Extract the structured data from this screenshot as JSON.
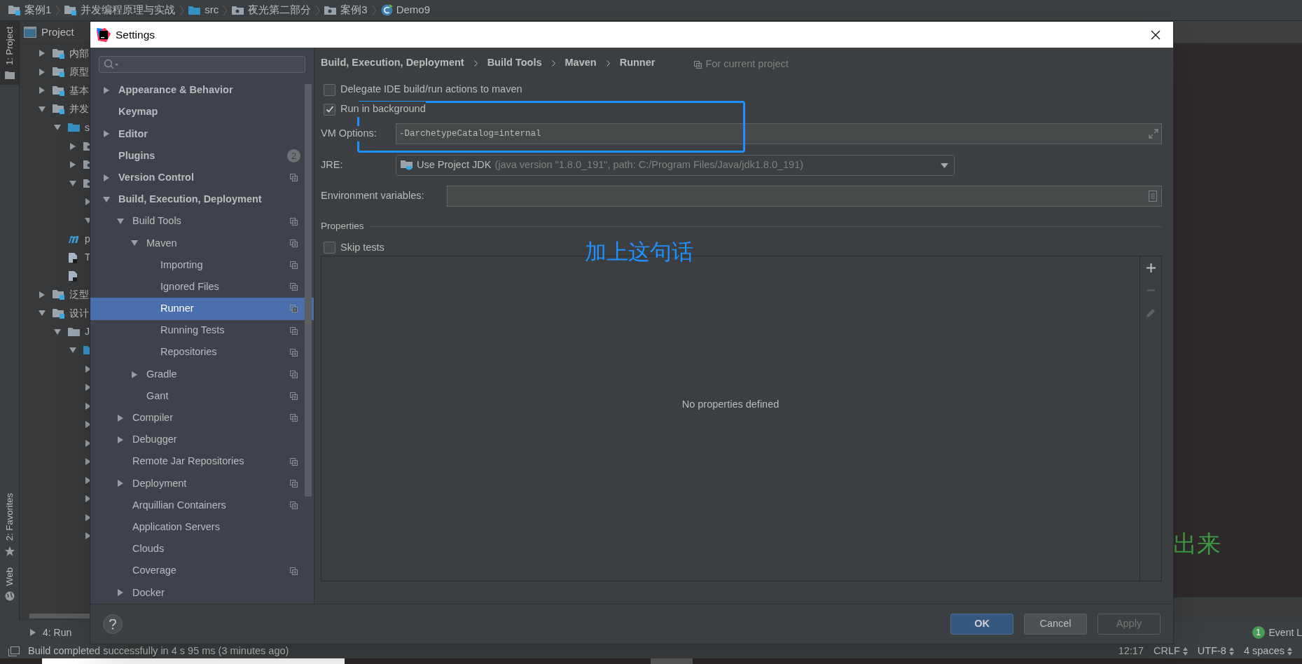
{
  "breadcrumbs": [
    {
      "label": "案例1",
      "kind": "module"
    },
    {
      "label": "并发编程原理与实战",
      "kind": "module"
    },
    {
      "label": "src",
      "kind": "source"
    },
    {
      "label": "夜光第二部分",
      "kind": "package"
    },
    {
      "label": "案例3",
      "kind": "package"
    },
    {
      "label": "Demo9",
      "kind": "class"
    }
  ],
  "side_tabs": [
    {
      "label": "1: Project",
      "kind": "project",
      "selected": true
    },
    {
      "label": "2: Favorites",
      "kind": "favorites",
      "selected": false
    },
    {
      "label": "Web",
      "kind": "web",
      "selected": false
    }
  ],
  "project_panel": {
    "title": "Project",
    "tree": [
      {
        "label": "内部",
        "kind": "module",
        "expanded": false
      },
      {
        "label": "原型",
        "kind": "module",
        "expanded": false
      },
      {
        "label": "基本",
        "kind": "module",
        "expanded": false
      },
      {
        "label": "并发",
        "kind": "module",
        "expanded": true,
        "children": [
          {
            "label": "s",
            "kind": "source",
            "expanded": true,
            "children": [
              {
                "kind": "package",
                "expanded": false
              },
              {
                "kind": "package",
                "expanded": false
              },
              {
                "kind": "package",
                "expanded": true,
                "children": [
                  {
                    "expanded": false
                  },
                  {
                    "expanded": true
                  }
                ]
              }
            ]
          },
          {
            "label": "p",
            "kind": "pom"
          },
          {
            "label": "T",
            "kind": "file"
          },
          {
            "kind": "file"
          }
        ]
      },
      {
        "label": "泛型",
        "kind": "module",
        "expanded": false
      },
      {
        "label": "设计",
        "kind": "module",
        "expanded": true,
        "children": [
          {
            "label": "J",
            "kind": "folder",
            "expanded": true,
            "children": [
              {
                "kind": "source",
                "expanded": true,
                "children": [
                  {
                    "expanded": false
                  },
                  {
                    "expanded": false
                  },
                  {
                    "expanded": false
                  },
                  {
                    "expanded": false
                  },
                  {
                    "expanded": false
                  },
                  {
                    "expanded": false
                  },
                  {
                    "expanded": false
                  },
                  {
                    "expanded": false
                  },
                  {
                    "expanded": false
                  },
                  {
                    "expanded": false
                  }
                ]
              }
            ]
          }
        ]
      }
    ]
  },
  "editor": {
    "text": "出来"
  },
  "settings_dialog": {
    "title": "Settings",
    "tree": [
      {
        "label": "Appearance & Behavior",
        "kind": "group",
        "expanded": false,
        "project": false,
        "selected": false
      },
      {
        "label": "Keymap",
        "kind": "leaf",
        "project": false,
        "selected": false
      },
      {
        "label": "Editor",
        "kind": "group",
        "expanded": false,
        "project": false,
        "selected": false
      },
      {
        "label": "Plugins",
        "kind": "leaf",
        "project": false,
        "selected": false,
        "badge": "2"
      },
      {
        "label": "Version Control",
        "kind": "group",
        "expanded": false,
        "project": true,
        "selected": false
      },
      {
        "label": "Build, Execution, Deployment",
        "kind": "group",
        "expanded": true,
        "project": false,
        "selected": false,
        "children": [
          {
            "label": "Build Tools",
            "kind": "group",
            "expanded": true,
            "project": true,
            "selected": false,
            "children": [
              {
                "label": "Maven",
                "kind": "group",
                "expanded": true,
                "project": true,
                "selected": false,
                "children": [
                  {
                    "label": "Importing",
                    "kind": "leaf",
                    "project": true,
                    "selected": false
                  },
                  {
                    "label": "Ignored Files",
                    "kind": "leaf",
                    "project": true,
                    "selected": false
                  },
                  {
                    "label": "Runner",
                    "kind": "leaf",
                    "project": true,
                    "selected": true
                  },
                  {
                    "label": "Running Tests",
                    "kind": "leaf",
                    "project": true,
                    "selected": false
                  },
                  {
                    "label": "Repositories",
                    "kind": "leaf",
                    "project": true,
                    "selected": false
                  }
                ]
              },
              {
                "label": "Gradle",
                "kind": "group",
                "expanded": false,
                "project": true,
                "selected": false
              },
              {
                "label": "Gant",
                "kind": "leaf",
                "project": true,
                "selected": false
              }
            ]
          },
          {
            "label": "Compiler",
            "kind": "group",
            "expanded": false,
            "project": true,
            "selected": false
          },
          {
            "label": "Debugger",
            "kind": "group",
            "expanded": false,
            "project": false,
            "selected": false
          },
          {
            "label": "Remote Jar Repositories",
            "kind": "leaf",
            "project": true,
            "selected": false
          },
          {
            "label": "Deployment",
            "kind": "group",
            "expanded": false,
            "project": true,
            "selected": false
          },
          {
            "label": "Arquillian Containers",
            "kind": "leaf",
            "project": true,
            "selected": false
          },
          {
            "label": "Application Servers",
            "kind": "leaf",
            "project": false,
            "selected": false
          },
          {
            "label": "Clouds",
            "kind": "leaf",
            "project": false,
            "selected": false
          },
          {
            "label": "Coverage",
            "kind": "leaf",
            "project": true,
            "selected": false
          },
          {
            "label": "Docker",
            "kind": "group",
            "expanded": false,
            "project": false,
            "selected": false
          }
        ]
      }
    ],
    "breadcrumb": [
      "Build, Execution, Deployment",
      "Build Tools",
      "Maven",
      "Runner"
    ],
    "scope_note": "For current project",
    "options": [
      {
        "kind": "checkbox",
        "label": "Delegate IDE build/run actions to maven",
        "checked": false
      },
      {
        "kind": "checkbox",
        "label": "Run in background",
        "checked": true
      },
      {
        "kind": "text",
        "label": "VM Options:",
        "value": "-DarchetypeCatalog=internal"
      },
      {
        "kind": "select",
        "label": "JRE:",
        "value": "Use Project JDK",
        "detail": "(java version \"1.8.0_191\", path: C:/Program Files/Java/jdk1.8.0_191)"
      },
      {
        "kind": "env",
        "label": "Environment variables:"
      }
    ],
    "properties": {
      "title": "Properties",
      "skip_tests": {
        "label": "Skip tests",
        "checked": false
      },
      "empty_text": "No properties defined"
    },
    "buttons": [
      {
        "label": "OK",
        "kind": "primary"
      },
      {
        "label": "Cancel",
        "kind": "normal"
      },
      {
        "label": "Apply",
        "kind": "disabled"
      }
    ]
  },
  "annotation": {
    "note": "加上这句话"
  },
  "tool_bar": {
    "run": "4: Run",
    "event_count": "1",
    "event_log": "Event L"
  },
  "status_bar": {
    "message": "Build completed successfully in 4 s 95 ms (3 minutes ago)",
    "items": [
      {
        "label": "12:17",
        "kind": "plain"
      },
      {
        "label": "CRLF",
        "kind": "menu"
      },
      {
        "label": "UTF-8",
        "kind": "menu"
      },
      {
        "label": "4 spaces",
        "kind": "menu"
      }
    ]
  }
}
